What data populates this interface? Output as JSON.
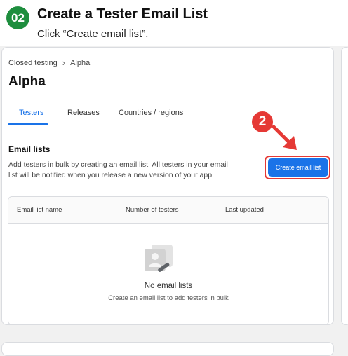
{
  "step": {
    "badge": "02",
    "title": "Create a Tester Email List",
    "subtitle": "Click “Create email list”."
  },
  "breadcrumb": {
    "parent": "Closed testing",
    "separator": "›",
    "current": "Alpha"
  },
  "page_title": "Alpha",
  "tabs": [
    {
      "label": "Testers",
      "active": true
    },
    {
      "label": "Releases",
      "active": false
    },
    {
      "label": "Countries / regions",
      "active": false
    }
  ],
  "email_lists": {
    "title": "Email lists",
    "description": "Add testers in bulk by creating an email list. All testers in your email list will be notified when you release a new version of your app.",
    "create_button": "Create email list"
  },
  "annotation": {
    "step_number": "2",
    "color": "#e53935"
  },
  "table": {
    "columns": [
      "Email list name",
      "Number of testers",
      "Last updated"
    ],
    "empty_title": "No email lists",
    "empty_subtitle": "Create an email list to add testers in bulk"
  },
  "colors": {
    "accent": "#1a73e8",
    "step_badge": "#1e8e3e",
    "highlight": "#e53935"
  },
  "icons": {
    "empty_state": "email-list-icon",
    "breadcrumb_separator": "chevron-right-icon",
    "annotation_arrow": "arrow-down-right-icon"
  }
}
